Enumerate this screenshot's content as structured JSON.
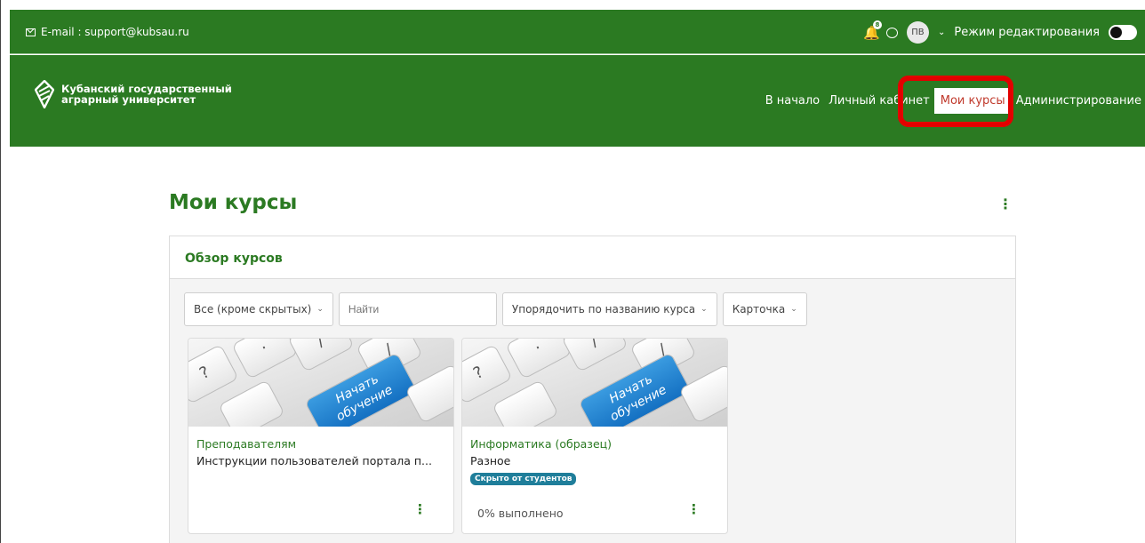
{
  "topbar": {
    "email": "E-mail : support@kubsau.ru",
    "notification_count": "8",
    "avatar_initials": "ПВ",
    "edit_mode_label": "Режим редактирования"
  },
  "brand": {
    "line1": "Кубанский государственный",
    "line2": "аграрный университет"
  },
  "nav": {
    "home": "В начало",
    "cabinet": "Личный кабинет",
    "my_courses": "Мои курсы",
    "admin": "Администрирование"
  },
  "page": {
    "title": "Мои курсы",
    "block_title": "Обзор курсов"
  },
  "filters": {
    "grouping": "Все (кроме скрытых)",
    "search_placeholder": "Найти",
    "sort": "Упорядочить по названию курса",
    "view": "Карточка"
  },
  "courses": [
    {
      "category": "Преподавателям",
      "name": "Инструкции пользователей портала п...",
      "image_text": "Начать обучение"
    },
    {
      "category": "Информатика (образец)",
      "name": "Разное",
      "badge": "Скрыто от студентов",
      "progress": "0% выполнено",
      "image_text": "Начать обучение"
    }
  ],
  "colors": {
    "brand_green": "#2b7a22",
    "active_text": "#c0392b",
    "highlight": "#e30000",
    "badge": "#1f7e9a"
  }
}
